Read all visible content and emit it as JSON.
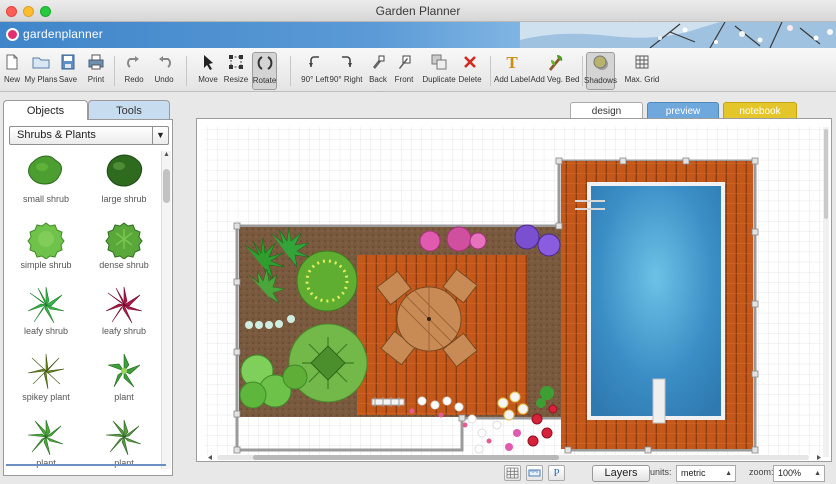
{
  "window": {
    "title": "Garden Planner"
  },
  "brand": {
    "name": "gardenplanner"
  },
  "toolbar": [
    {
      "label": "New",
      "icon": "new-file-icon"
    },
    {
      "label": "My Plans",
      "icon": "folder-icon"
    },
    {
      "label": "Save",
      "icon": "save-icon"
    },
    {
      "label": "Print",
      "icon": "print-icon"
    },
    {
      "label": "Redo",
      "icon": "redo-icon"
    },
    {
      "label": "Undo",
      "icon": "undo-icon"
    },
    {
      "label": "Move",
      "icon": "move-arrow-icon"
    },
    {
      "label": "Resize",
      "icon": "resize-icon"
    },
    {
      "label": "Rotate",
      "icon": "rotate-icon",
      "active": true
    },
    {
      "label": "90° Left",
      "icon": "rotate-left-icon"
    },
    {
      "label": "90° Right",
      "icon": "rotate-right-icon"
    },
    {
      "label": "Back",
      "icon": "send-back-icon"
    },
    {
      "label": "Front",
      "icon": "bring-front-icon"
    },
    {
      "label": "Duplicate",
      "icon": "duplicate-icon"
    },
    {
      "label": "Delete",
      "icon": "delete-x-icon"
    },
    {
      "label": "Add Label",
      "icon": "text-label-icon"
    },
    {
      "label": "Add Veg. Bed",
      "icon": "veg-bed-icon"
    },
    {
      "label": "Shadows",
      "icon": "shadows-icon",
      "active": true
    },
    {
      "label": "Max. Grid",
      "icon": "grid-icon"
    }
  ],
  "left_tabs": {
    "objects": "Objects",
    "tools": "Tools"
  },
  "category": "Shrubs & Plants",
  "objects": [
    {
      "label": "small shrub"
    },
    {
      "label": "large shrub"
    },
    {
      "label": "simple shrub"
    },
    {
      "label": "dense shrub"
    },
    {
      "label": "leafy shrub"
    },
    {
      "label": "leafy shrub"
    },
    {
      "label": "spikey plant"
    },
    {
      "label": "plant"
    },
    {
      "label": "plant"
    },
    {
      "label": "plant"
    }
  ],
  "view_tabs": {
    "design": "design",
    "preview": "preview",
    "notebook": "notebook"
  },
  "status": {
    "layers": "Layers",
    "units_label": "units:",
    "units_value": "metric",
    "zoom_label": "zoom:",
    "zoom_value": "100%",
    "text_tool": "P"
  },
  "colors": {
    "brand_blue": "#4a8fd0",
    "design_tab": "#ffffff",
    "preview_tab": "#6fa8dc",
    "notebook_tab": "#e5c62a",
    "deck": "#c4581a",
    "pool_water": "#3b8fc6",
    "soil": "#7a5a3e"
  }
}
